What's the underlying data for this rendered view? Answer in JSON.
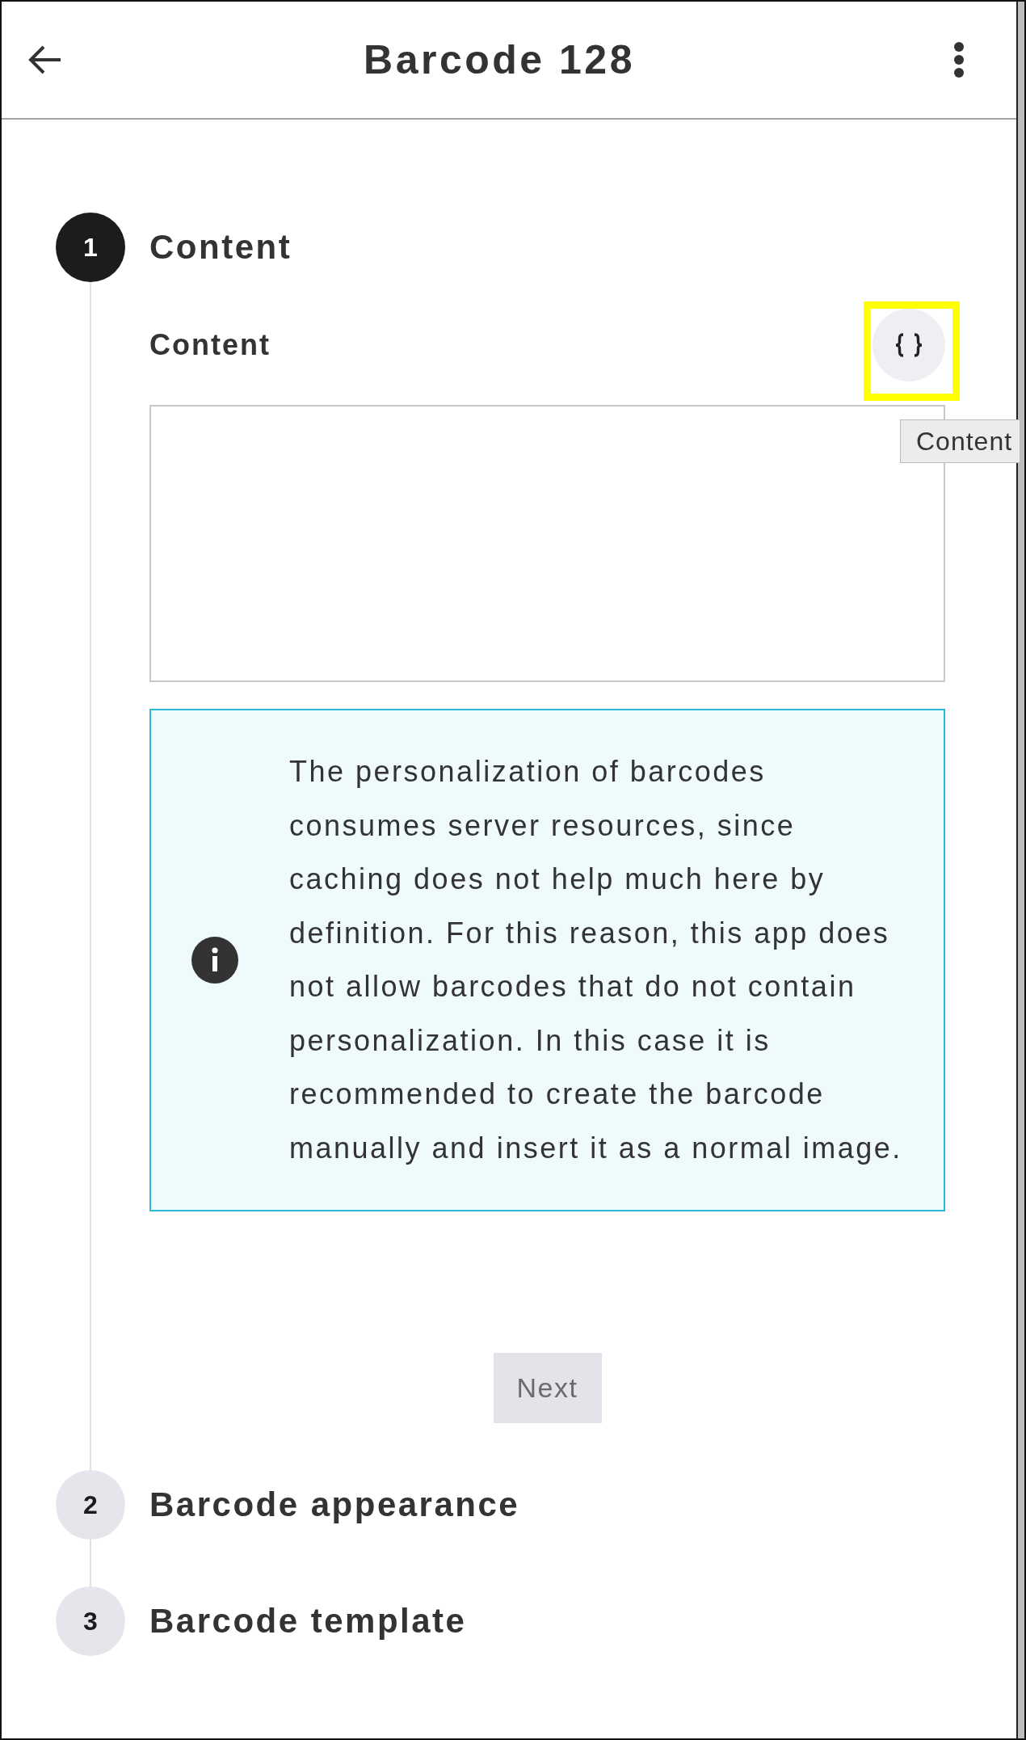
{
  "app_bar": {
    "title": "Barcode 128"
  },
  "steps": [
    {
      "number": "1",
      "title": "Content",
      "selected": true,
      "content": {
        "field": {
          "label": "Content",
          "insert_button": {
            "highlighted": true,
            "tooltip": "Content"
          }
        },
        "info": "The personalization of barcodes consumes server resources, since caching does not help much here by definition. For this reason, this app does not allow barcodes that do not contain personalization. In this case it is recommended to create the barcode manually and insert it as a normal image.",
        "next_button": {
          "label": "Next",
          "disabled": true
        }
      }
    },
    {
      "number": "2",
      "title": "Barcode appearance",
      "selected": false
    },
    {
      "number": "3",
      "title": "Barcode template",
      "selected": false
    }
  ]
}
